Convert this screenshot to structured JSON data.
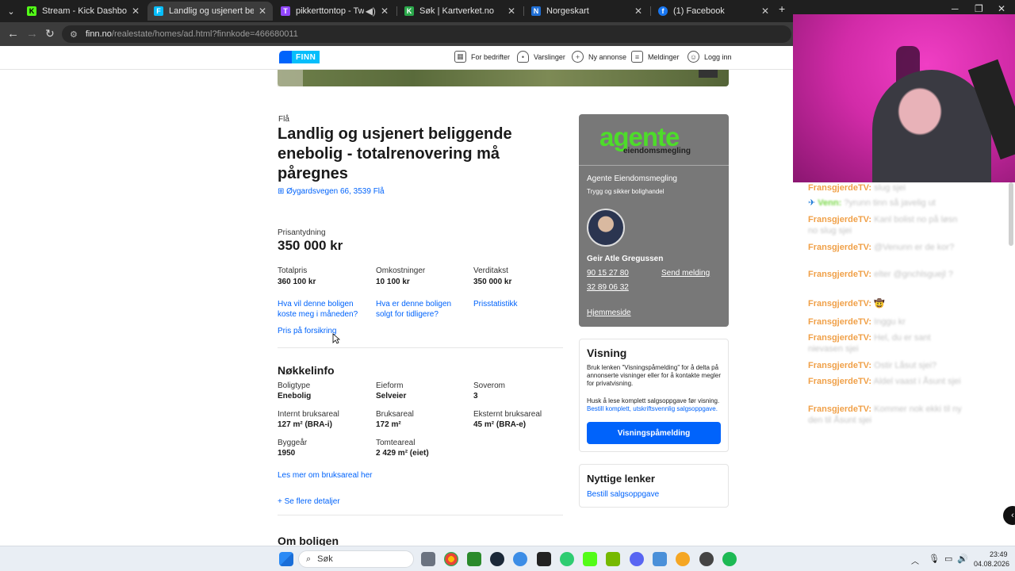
{
  "browser": {
    "tabs": [
      {
        "title": "Stream - Kick Dashboard",
        "fav": "K",
        "color": "#53fc18"
      },
      {
        "title": "Landlig og usjenert beliggende",
        "fav": "F",
        "color": "#06befb"
      },
      {
        "title": "pikkerttontop - Twitch",
        "fav": "T",
        "color": "#9146ff"
      },
      {
        "title": "Søk | Kartverket.no",
        "fav": "K",
        "color": "#2aa84a"
      },
      {
        "title": "Norgeskart",
        "fav": "N",
        "color": "#1f6fd6"
      },
      {
        "title": "(1) Facebook",
        "fav": "f",
        "color": "#1877f2"
      }
    ],
    "url_domain": "finn.no",
    "url_path": "/realestate/homes/ad.html?finnkode=466680011"
  },
  "finn": {
    "logo_text": "FINN",
    "nav": {
      "bedrifter": "For bedrifter",
      "varslinger": "Varslinger",
      "ny_annonse": "Ny annonse",
      "meldinger": "Meldinger",
      "logg_inn": "Logg inn"
    }
  },
  "listing": {
    "location": "Flå",
    "title": "Landlig og usjenert beliggende enebolig - totalrenovering må påregnes",
    "address": "Øygardsvegen 66, 3539 Flå",
    "price_label": "Prisantydning",
    "price": "350 000 kr",
    "costs": [
      {
        "label": "Totalpris",
        "value": "360 100 kr"
      },
      {
        "label": "Omkostninger",
        "value": "10 100 kr"
      },
      {
        "label": "Verditakst",
        "value": "350 000 kr"
      }
    ],
    "links": {
      "monthly": "Hva vil denne boligen koste meg i måneden?",
      "sold_before": "Hva er denne boligen solgt for tidligere?",
      "prisstatistikk": "Prisstatistikk",
      "forsikring": "Pris på forsikring"
    },
    "keyinfo_heading": "Nøkkelinfo",
    "keyinfo": [
      {
        "label": "Boligtype",
        "value": "Enebolig"
      },
      {
        "label": "Eieform",
        "value": "Selveier"
      },
      {
        "label": "Soverom",
        "value": "3"
      },
      {
        "label": "Internt bruksareal",
        "value": "127 m² (BRA-i)"
      },
      {
        "label": "Bruksareal",
        "value": "172 m²"
      },
      {
        "label": "Eksternt bruksareal",
        "value": "45 m² (BRA-e)"
      },
      {
        "label": "Byggeår",
        "value": "1950"
      },
      {
        "label": "Tomteareal",
        "value": "2 429 m² (eiet)"
      }
    ],
    "bruksareal_link": "Les mer om bruksareal her",
    "more_details": "Se flere detaljer",
    "om_boligen": "Om boligen"
  },
  "agent": {
    "logo_main": "agente",
    "logo_sub": "eiendomsmegling",
    "company": "Agente Eiendomsmegling",
    "tagline": "Trygg og sikker bolighandel",
    "name": "Geir Atle Gregussen",
    "phone1": "90 15 27 80",
    "phone2": "32 89 06 32",
    "send": "Send melding",
    "homepage": "Hjemmeside"
  },
  "visning": {
    "heading": "Visning",
    "text1": "Bruk lenken \"Visningspåmelding\" for å delta på annonserte visninger eller for å kontakte megler for privatvisning.",
    "text2": "Husk å lese komplett salgsoppgave før visning.",
    "link": "Bestill komplett, utskriftsvennlig salgsoppgave.",
    "button": "Visningspåmelding"
  },
  "nyttige": {
    "heading": "Nyttige lenker",
    "link": "Bestill salgsoppgave"
  },
  "chat": [
    {
      "user": "FransgjerdeTV:",
      "msg": "slug sjei"
    },
    {
      "user": "Venn:",
      "msg": "?yrunn tinn så javelig ut"
    },
    {
      "user": "FransgjerdeTV:",
      "msg": "Kanl bolist no på løsn no slug sjei"
    },
    {
      "user": "FransgjerdeTV:",
      "msg": "@Venunn er de kor?"
    },
    {
      "user": "FransgjerdeTV:",
      "msg": "elter @gnchlsguejl ?"
    },
    {
      "user": "FransgjerdeTV:",
      "msg": "🤠"
    },
    {
      "user": "FransgjerdeTV:",
      "msg": "Inggu kr"
    },
    {
      "user": "FransgjerdeTV:",
      "msg": "Hel, du er sant nievasen sjei"
    },
    {
      "user": "FransgjerdeTV:",
      "msg": "Ostir Låsut sjei?"
    },
    {
      "user": "FransgjerdeTV:",
      "msg": "Aldel vaast i Åsunt sjei"
    },
    {
      "user": "FransgjerdeTV:",
      "msg": "Kommer nok ekki til ny den til Åsunt sjei"
    }
  ],
  "taskbar": {
    "search": "Søk",
    "time": "23:49",
    "date": "04.08.2026"
  }
}
